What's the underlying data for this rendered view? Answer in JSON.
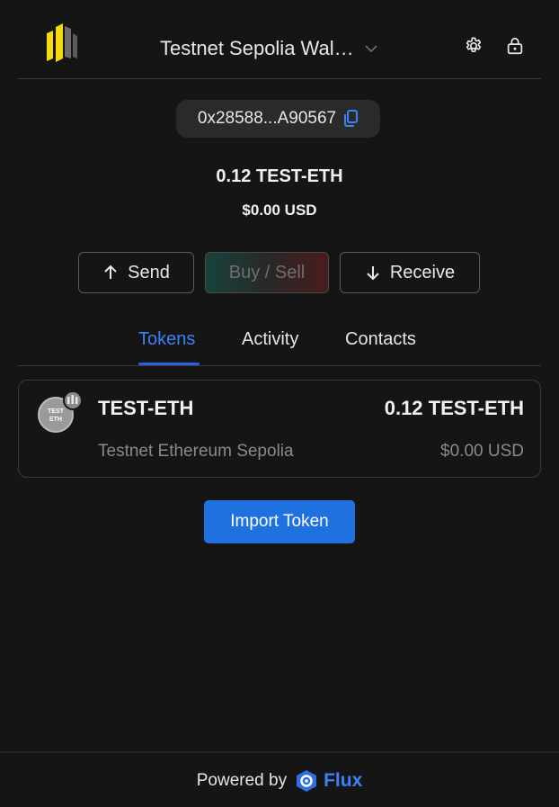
{
  "header": {
    "wallet_name": "Testnet Sepolia Wal…",
    "settings_icon": "gear-icon",
    "lock_icon": "lock-icon",
    "chevron_icon": "chevron-down-icon"
  },
  "account": {
    "address": "0x28588...A90567",
    "copy_icon": "copy-icon"
  },
  "balance": {
    "amount": "0.12 TEST-ETH",
    "usd": "$0.00 USD"
  },
  "actions": {
    "send_label": "Send",
    "buy_sell_label": "Buy / Sell",
    "receive_label": "Receive"
  },
  "tabs": [
    {
      "label": "Tokens",
      "active": true
    },
    {
      "label": "Activity",
      "active": false
    },
    {
      "label": "Contacts",
      "active": false
    }
  ],
  "tokens": [
    {
      "symbol": "TEST-ETH",
      "name": "Testnet Ethereum Sepolia",
      "amount": "0.12 TEST-ETH",
      "value": "$0.00 USD",
      "icon_text_top": "TEST",
      "icon_text_bottom": "ETH"
    }
  ],
  "import_button_label": "Import Token",
  "footer": {
    "powered_by": "Powered by",
    "brand": "Flux"
  },
  "colors": {
    "background": "#151515",
    "accent": "#3b82f6",
    "primary_button": "#2071e0",
    "logo_yellow": "#f5d90a"
  }
}
